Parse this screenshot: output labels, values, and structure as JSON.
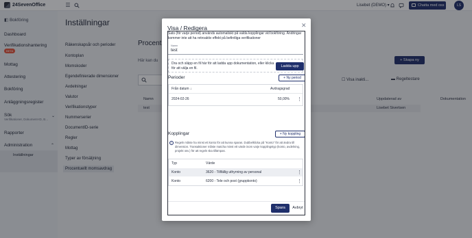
{
  "app": {
    "name": "24SevenOffice"
  },
  "topbar": {
    "menu_icon": "hamburger-icon",
    "search_icon": "search-icon",
    "user": "Lisebet (DEMO)",
    "chat_label": "Chatta med oss",
    "avatar_initials": "LS"
  },
  "sidebar": {
    "section": "Bokföring",
    "items": [
      {
        "label": "Dashboard"
      },
      {
        "label": "Verifikationshantering",
        "badge": "BETA"
      },
      {
        "label": "Mottag"
      },
      {
        "label": "Attestering"
      },
      {
        "label": "Bokföring"
      },
      {
        "label": "Anläggningsregister"
      },
      {
        "label": "Sök",
        "sub": "Verifikationer, Dokument-ID, B..."
      },
      {
        "label": "Rapporter"
      },
      {
        "label": "Administration"
      },
      {
        "label": "Inställningar"
      }
    ]
  },
  "main": {
    "title": "Inställningar",
    "subnav": [
      "Räkenskapsår och perioder",
      "Kontoplan",
      "Momskoder",
      "Egendefinierade dimensioner",
      "Avdelningar",
      "Valutor",
      "Verifikationstyper",
      "Nummerserier",
      "DocumentID-serie",
      "Regler",
      "Mottag",
      "Typer av försäljning",
      "Procentuellt momsavdrag"
    ],
    "panel_title": "Procent",
    "panel_text": "Här kan du",
    "create_label": "Skapa ny",
    "show_inactive": "Visa inakti...",
    "rules_label": "Regeltestare",
    "columns": [
      "Namn",
      "Uppdaterad av",
      "Dokumentation"
    ],
    "row": {
      "name": "test",
      "updated_by": "Lisebet Sivertsen"
    }
  },
  "modal": {
    "title": "Visa / Redigera",
    "intro": "Sats (för varje period) används automatiskt på valda kopplingar vid bokföring. Ändringar kommer inte att ha retroaktiv effekt på befintliga verifikationer",
    "name_label": "Namn",
    "name_value": "test",
    "dropzone_text": "Dra och släpp en fil här för att ladda upp dokumentation, eller klicka för att välja en fil.",
    "upload_label": "Ladda upp",
    "periods": {
      "title": "Perioder",
      "new_label": "Ny period",
      "col_from": "Från datum",
      "col_rate": "Avdragsgrad",
      "rows": [
        {
          "from": "2024-02-26",
          "rate": "50,00%"
        }
      ]
    },
    "links": {
      "title": "Kopplingar",
      "new_label": "Ny koppling",
      "info": "Regeln måste ha minst ett konto för att kunna sparas. Dubbelklicka på \"Konto\" för att ändra till dimension. Transaktioner måste matcha minst ett värde inom varje kopplingstyp (konto, avdelning, projekt osv.) för att regeln ska tillämpas.",
      "col_type": "Typ",
      "col_value": "Värde",
      "rows": [
        {
          "type": "Konto",
          "value": "3620 - Tillfällig uthyrning av personal"
        },
        {
          "type": "Konto",
          "value": "6200 - Tele och post (gruppkonto)"
        }
      ]
    },
    "save_label": "Spara",
    "cancel_label": "Avbryt"
  },
  "colors": {
    "primary": "#1f2f6b",
    "beta": "#e8533a"
  }
}
